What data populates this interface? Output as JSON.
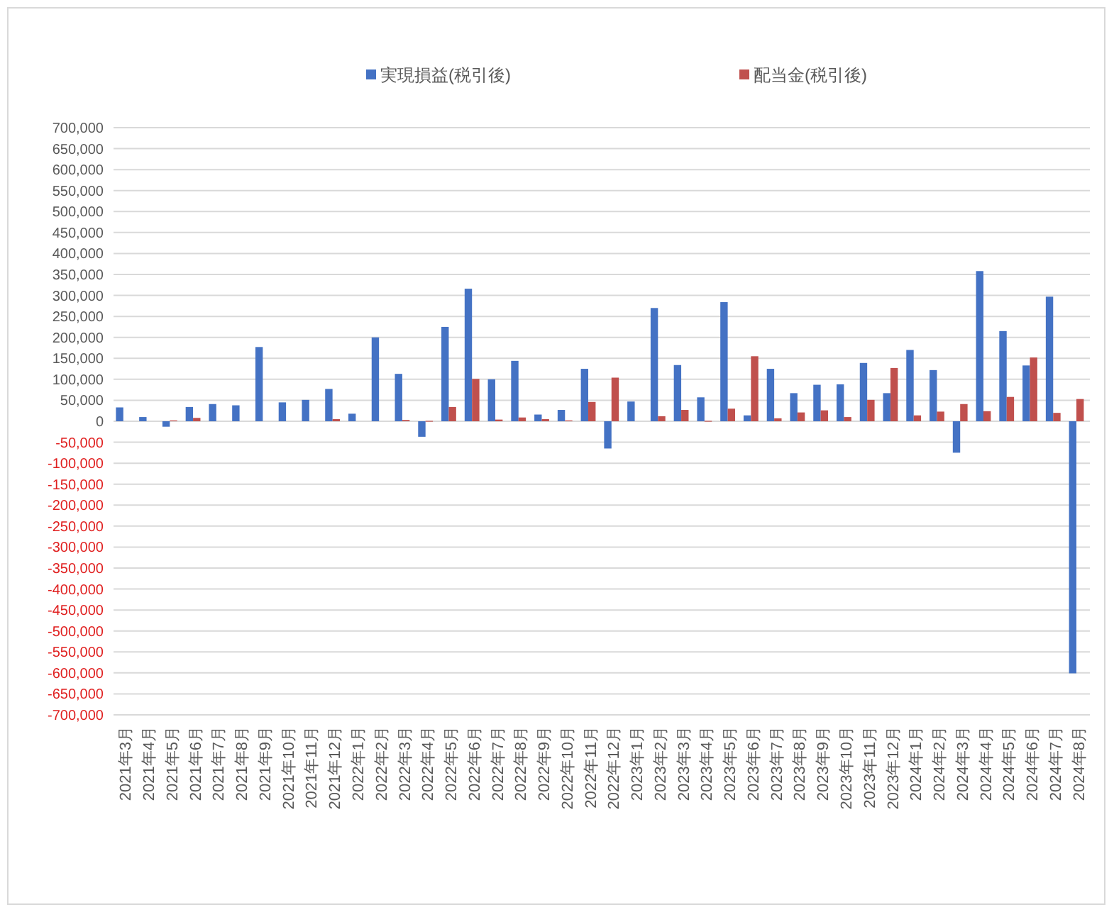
{
  "chart_data": {
    "type": "bar",
    "categories": [
      "2021年3月",
      "2021年4月",
      "2021年5月",
      "2021年6月",
      "2021年7月",
      "2021年8月",
      "2021年9月",
      "2021年10月",
      "2021年11月",
      "2021年12月",
      "2022年1月",
      "2022年2月",
      "2022年3月",
      "2022年4月",
      "2022年5月",
      "2022年6月",
      "2022年7月",
      "2022年8月",
      "2022年9月",
      "2022年10月",
      "2022年11月",
      "2022年12月",
      "2023年1月",
      "2023年2月",
      "2023年3月",
      "2023年4月",
      "2023年5月",
      "2023年6月",
      "2023年7月",
      "2023年8月",
      "2023年9月",
      "2023年10月",
      "2023年11月",
      "2023年12月",
      "2024年1月",
      "2024年2月",
      "2024年3月",
      "2024年4月",
      "2024年5月",
      "2024年6月",
      "2024年7月",
      "2024年8月"
    ],
    "series": [
      {
        "name": "実現損益(税引後)",
        "color": "#4472c4",
        "values": [
          33000,
          10000,
          -13000,
          34000,
          41000,
          38000,
          177000,
          45000,
          51000,
          77000,
          18000,
          200000,
          113000,
          -37000,
          225000,
          316000,
          100000,
          144000,
          16000,
          27000,
          125000,
          -65000,
          47000,
          270000,
          134000,
          57000,
          284000,
          14000,
          125000,
          67000,
          87000,
          88000,
          139000,
          67000,
          170000,
          122000,
          -75000,
          358000,
          215000,
          133000,
          297000,
          -601000
        ]
      },
      {
        "name": "配当金(税引後)",
        "color": "#c0504d",
        "values": [
          0,
          0,
          2000,
          8000,
          0,
          0,
          0,
          0,
          0,
          5000,
          0,
          0,
          3000,
          1000,
          34000,
          101000,
          4000,
          9000,
          5000,
          2000,
          46000,
          104000,
          0,
          12000,
          27000,
          1000,
          30000,
          155000,
          7000,
          21000,
          26000,
          10000,
          51000,
          127000,
          14000,
          23000,
          41000,
          24000,
          58000,
          152000,
          20000,
          53000
        ]
      }
    ],
    "ylim": [
      -700000,
      700000
    ],
    "grid": true,
    "legend": true,
    "yticks": [
      {
        "value": 700000,
        "label": "700,000"
      },
      {
        "value": 650000,
        "label": "650,000"
      },
      {
        "value": 600000,
        "label": "600,000"
      },
      {
        "value": 550000,
        "label": "550,000"
      },
      {
        "value": 500000,
        "label": "500,000"
      },
      {
        "value": 450000,
        "label": "450,000"
      },
      {
        "value": 400000,
        "label": "400,000"
      },
      {
        "value": 350000,
        "label": "350,000"
      },
      {
        "value": 300000,
        "label": "300,000"
      },
      {
        "value": 250000,
        "label": "250,000"
      },
      {
        "value": 200000,
        "label": "200,000"
      },
      {
        "value": 150000,
        "label": "150,000"
      },
      {
        "value": 100000,
        "label": "100,000"
      },
      {
        "value": 50000,
        "label": "50,000"
      },
      {
        "value": 0,
        "label": "0"
      },
      {
        "value": -50000,
        "label": "-50,000"
      },
      {
        "value": -100000,
        "label": "-100,000"
      },
      {
        "value": -150000,
        "label": "-150,000"
      },
      {
        "value": -200000,
        "label": "-200,000"
      },
      {
        "value": -250000,
        "label": "-250,000"
      },
      {
        "value": -300000,
        "label": "-300,000"
      },
      {
        "value": -350000,
        "label": "-350,000"
      },
      {
        "value": -400000,
        "label": "-400,000"
      },
      {
        "value": -450000,
        "label": "-450,000"
      },
      {
        "value": -500000,
        "label": "-500,000"
      },
      {
        "value": -550000,
        "label": "-550,000"
      },
      {
        "value": -600000,
        "label": "-600,000"
      },
      {
        "value": -650000,
        "label": "-650,000"
      },
      {
        "value": -700000,
        "label": "-700,000"
      }
    ]
  }
}
